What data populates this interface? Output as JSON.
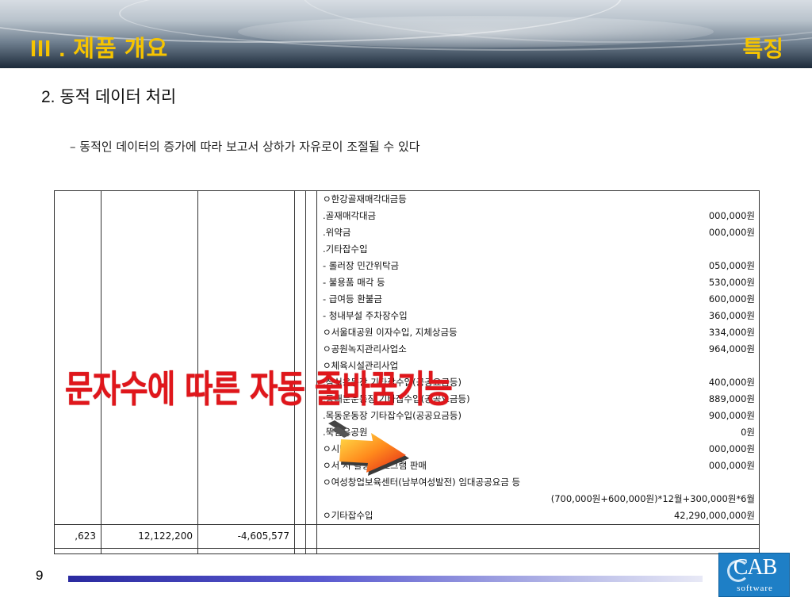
{
  "header": {
    "title": "III . 제품 개요",
    "feature": "특징"
  },
  "section_title": "2. 동적 데이터 처리",
  "description": "– 동적인 데이터의 증가에 따라 보고서 상하가 자유로이 조절될 수 있다",
  "report": {
    "rows": [
      {
        "label": "ㅇ한강골재매각대금등",
        "amount": ""
      },
      {
        "label": ".골재매각대금",
        "amount": "000,000원"
      },
      {
        "label": ".위약금",
        "amount": "000,000원"
      },
      {
        "label": ".기타잡수입",
        "amount": ""
      },
      {
        "label": "- 롤러장 민간위탁금",
        "amount": "050,000원"
      },
      {
        "label": "- 불용품 매각 등",
        "amount": "530,000원"
      },
      {
        "label": "- 급여등 환불금",
        "amount": "600,000원"
      },
      {
        "label": "- 청내부설 주차장수입",
        "amount": "360,000원"
      },
      {
        "label": "ㅇ서울대공원 이자수입, 지체상금등",
        "amount": "334,000원"
      },
      {
        "label": "ㅇ공원녹지관리사업소",
        "amount": "964,000원"
      },
      {
        "label": "ㅇ체육시설관리사업",
        "amount": ""
      },
      {
        "label": ".잠실운동장 기타잡수입(공공요금등)",
        "amount": "400,000원"
      },
      {
        "label": ".동대문운동장 기타잡수입(공공요금등)",
        "amount": "889,000원"
      },
      {
        "label": ".목동운동장 기타잡수입(공공요금등)",
        "amount": "900,000원"
      },
      {
        "label": ".뚝섬유공원",
        "amount": "0원"
      },
      {
        "label": "ㅇ시민      잡수입등",
        "amount": "000,000원"
      },
      {
        "label": "ㅇ서        서 활용 프로그램 판매",
        "amount": "000,000원"
      },
      {
        "label": "ㅇ여성창업보육센터(남부여성발전) 임대공공요금 등",
        "amount": ""
      },
      {
        "label": "",
        "amount": "(700,000원+600,000원)*12월+300,000원*6월"
      },
      {
        "label": "ㅇ기타잡수입",
        "amount": "42,290,000,000원"
      }
    ],
    "bottom": {
      "col1": ",623",
      "col2": "12,122,200",
      "col3": "-4,605,577"
    }
  },
  "overlay_caption": "문자수에 따른 자동 줄바꿈기능",
  "footer": {
    "page_number": "9",
    "logo_text": "CAB",
    "logo_sub": "software"
  },
  "colors": {
    "title_yellow": "#f6c400",
    "overlay_red": "#e0161b",
    "logo_blue": "#1e7fc6"
  }
}
